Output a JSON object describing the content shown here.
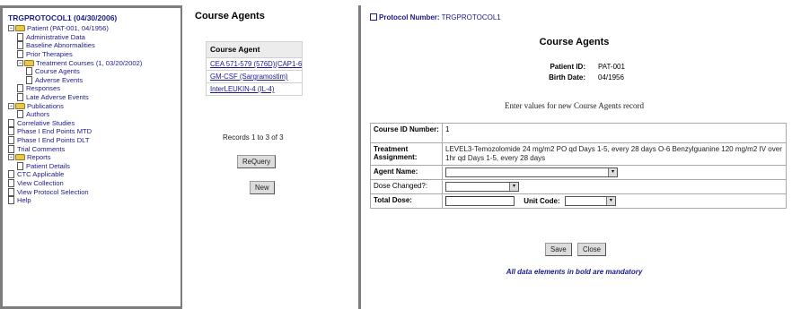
{
  "left_panel": {
    "title": "TRGPROTOCOL1 (04/30/2006)",
    "tree": [
      {
        "level": 1,
        "type": "folder",
        "expanded": true,
        "label": "Patient (PAT-001, 04/1956)"
      },
      {
        "level": 2,
        "type": "page",
        "label": "Administrative Data"
      },
      {
        "level": 2,
        "type": "page",
        "label": "Baseline Abnormalities"
      },
      {
        "level": 2,
        "type": "page",
        "label": "Prior Therapies"
      },
      {
        "level": 2,
        "type": "folder",
        "expanded": true,
        "label": "Treatment Courses (1, 03/20/2002)"
      },
      {
        "level": 3,
        "type": "page",
        "label": "Course Agents"
      },
      {
        "level": 3,
        "type": "page",
        "label": "Adverse Events"
      },
      {
        "level": 2,
        "type": "page",
        "label": "Responses"
      },
      {
        "level": 2,
        "type": "page",
        "label": "Late Adverse Events"
      },
      {
        "level": 1,
        "type": "folder",
        "expanded": true,
        "label": "Publications"
      },
      {
        "level": 2,
        "type": "page",
        "label": "Authors"
      },
      {
        "level": 1,
        "type": "page",
        "label": "Correlative Studies"
      },
      {
        "level": 1,
        "type": "page",
        "label": "Phase I End Points MTD"
      },
      {
        "level": 1,
        "type": "page",
        "label": "Phase I End Points DLT"
      },
      {
        "level": 1,
        "type": "page",
        "label": "Trial Comments"
      },
      {
        "level": 1,
        "type": "folder",
        "expanded": true,
        "label": "Reports"
      },
      {
        "level": 2,
        "type": "page",
        "label": "Patient Details"
      },
      {
        "level": 1,
        "type": "page",
        "label": "CTC Applicable"
      },
      {
        "level": 1,
        "type": "page",
        "label": "View Collection"
      },
      {
        "level": 1,
        "type": "page",
        "label": "View Protocol Selection"
      },
      {
        "level": 1,
        "type": "page",
        "label": "Help"
      }
    ]
  },
  "middle_panel": {
    "title": "Course Agents",
    "table_header": "Course Agent",
    "agents": [
      "CEA 571-579 (576D)(CAP1-6D)",
      "GM-CSF (Sargramostim)",
      "InterLEUKIN-4 (IL-4)"
    ],
    "records_text": "Records 1 to 3 of 3",
    "requery_label": "ReQuery",
    "new_label": "New"
  },
  "right_panel": {
    "protocol_label": "Protocol Number:",
    "protocol_value": "TRGPROTOCOL1",
    "title": "Course Agents",
    "patient_id_label": "Patient ID:",
    "patient_id_value": "PAT-001",
    "birth_date_label": "Birth Date:",
    "birth_date_value": "04/1956",
    "instruction": "Enter values for new Course Agents record",
    "form": {
      "course_id_label": "Course ID Number:",
      "course_id_value": "1",
      "treatment_label": "Treatment Assignment:",
      "treatment_value": "LEVEL3-Temozolomide 24 mg/m2 PO qd Days 1-5, every 28 days O-6 Benzylguanine 120 mg/m2 IV over 1hr qd Days 1-5, every 28 days",
      "agent_name_label": "Agent Name:",
      "dose_changed_label": "Dose Changed?:",
      "total_dose_label": "Total Dose:",
      "unit_code_label": "Unit Code:"
    },
    "save_label": "Save",
    "close_label": "Close",
    "mandatory_note": "All data elements in bold are mandatory"
  }
}
